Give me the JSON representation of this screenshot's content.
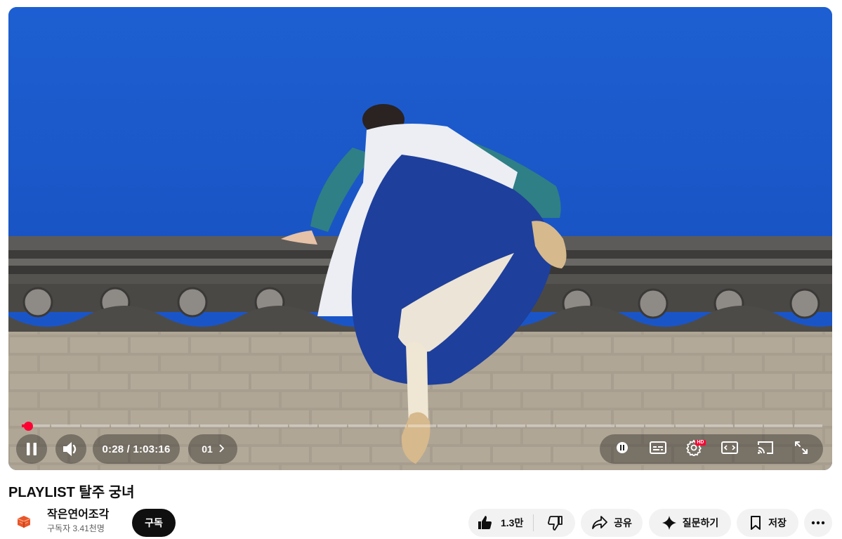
{
  "player": {
    "progress_fraction": 0.0075,
    "time_current": "0:28",
    "time_separator": " / ",
    "time_total": "1:03:16",
    "chapter_label": "01",
    "hd_badge": "HD",
    "accent_color": "#ff0033"
  },
  "icons": {
    "pause": "pause-icon",
    "volume": "volume-icon",
    "chevron": "chevron-right-icon",
    "autoplay": "autoplay-toggle-icon",
    "captions": "subtitles-icon",
    "settings": "gear-icon",
    "theater": "theater-mode-icon",
    "cast": "cast-icon",
    "fullscreen": "fullscreen-icon",
    "like": "thumbs-up-icon",
    "dislike": "thumbs-down-icon",
    "share": "share-icon",
    "ask": "sparkle-icon",
    "save": "bookmark-icon",
    "more": "more-horizontal-icon"
  },
  "video": {
    "title": "PLAYLIST 탈주 궁녀"
  },
  "channel": {
    "name": "작은연어조각",
    "subscribers": "구독자 3.41천명",
    "subscribe_label": "구독"
  },
  "actions": {
    "like_count": "1.3만",
    "share_label": "공유",
    "ask_label": "질문하기",
    "save_label": "저장"
  }
}
